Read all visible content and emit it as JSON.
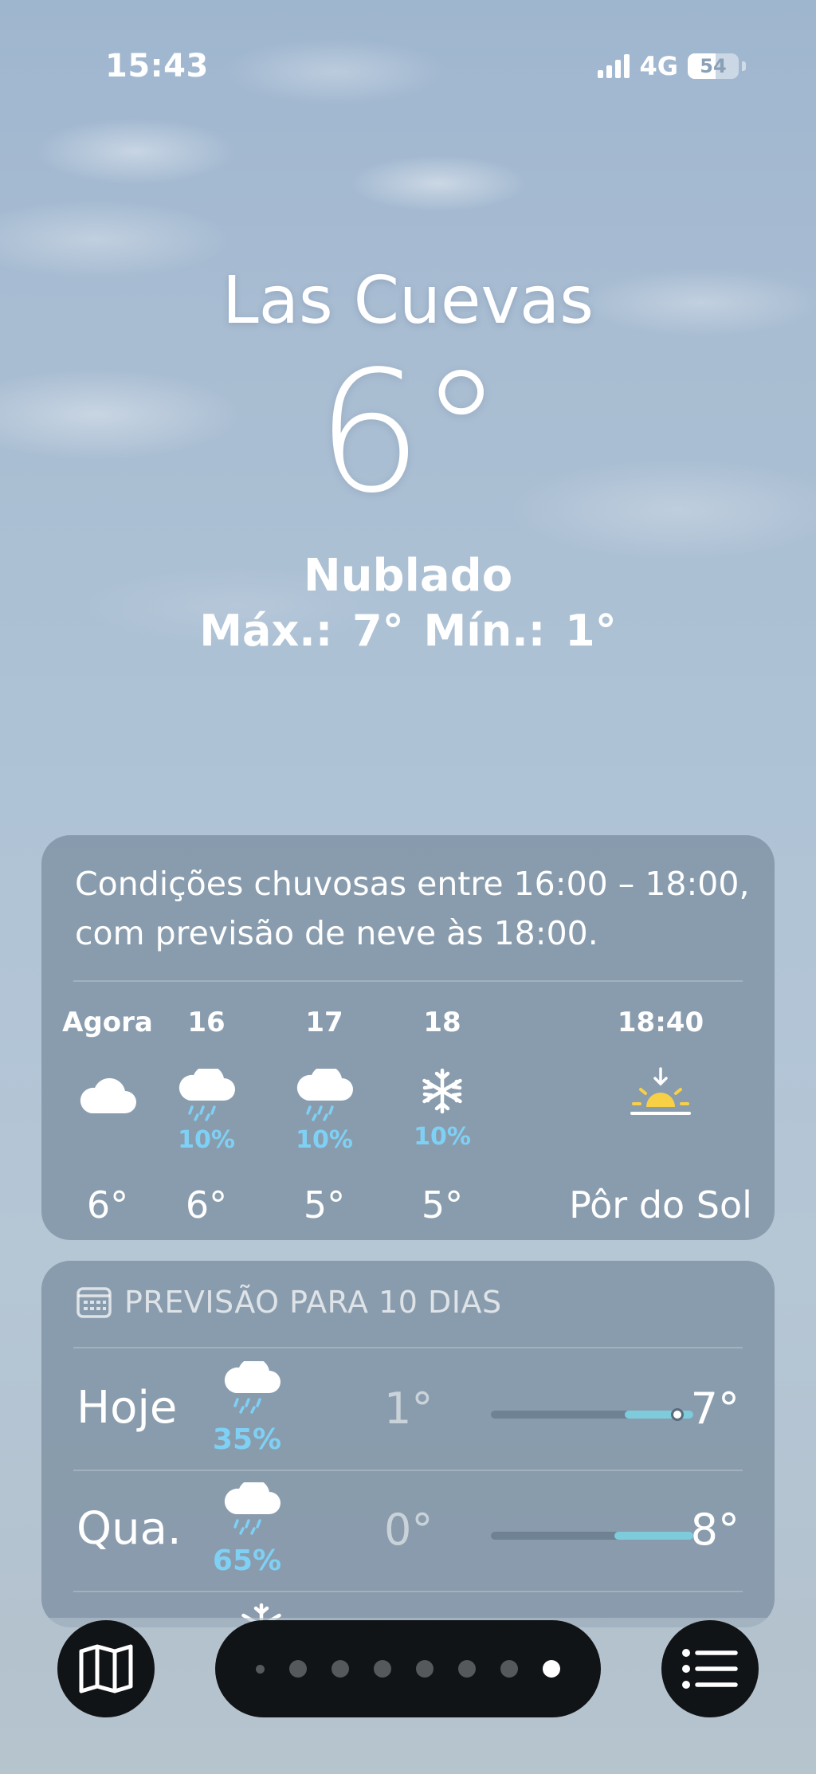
{
  "status_bar": {
    "time": "15:43",
    "network": "4G",
    "battery": "54",
    "battery_level_percent": 54
  },
  "header": {
    "city": "Las Cuevas",
    "temperature": "6°",
    "condition": "Nublado",
    "high_low": "Máx.: 7°  Mín.: 1°"
  },
  "hourly": {
    "summary": "Condições chuvosas entre 16:00 – 18:00, com previsão de neve às 18:00.",
    "items": [
      {
        "label": "Agora",
        "icon": "cloud-icon",
        "precip": "",
        "temp": "6°"
      },
      {
        "label": "16",
        "icon": "cloud-rain-icon",
        "precip": "10%",
        "temp": "6°"
      },
      {
        "label": "17",
        "icon": "cloud-rain-icon",
        "precip": "10%",
        "temp": "5°"
      },
      {
        "label": "18",
        "icon": "snowflake-icon",
        "precip": "10%",
        "temp": "5°"
      },
      {
        "label": "18:40",
        "icon": "sunset-icon",
        "precip": "",
        "temp": "Pôr do Sol"
      }
    ]
  },
  "daily": {
    "title": "PREVISÃO PARA 10 DIAS",
    "days": [
      {
        "day": "Hoje",
        "icon": "cloud-rain-icon",
        "precip": "35%",
        "low": "1°",
        "high": "7°",
        "bar_start": 0.66,
        "bar_end": 1.0,
        "current_pos": 0.92
      },
      {
        "day": "Qua.",
        "icon": "cloud-rain-icon",
        "precip": "65%",
        "low": "0°",
        "high": "8°",
        "bar_start": 0.61,
        "bar_end": 1.0
      }
    ]
  },
  "bottom_bar": {
    "map_icon": "map-icon",
    "list_icon": "list-icon",
    "page_count": 8,
    "active_page": 8
  },
  "colors": {
    "precip_blue": "#7fd0f5",
    "temp_bar": "#7ecbdc",
    "sun_yellow": "#f7d046"
  }
}
